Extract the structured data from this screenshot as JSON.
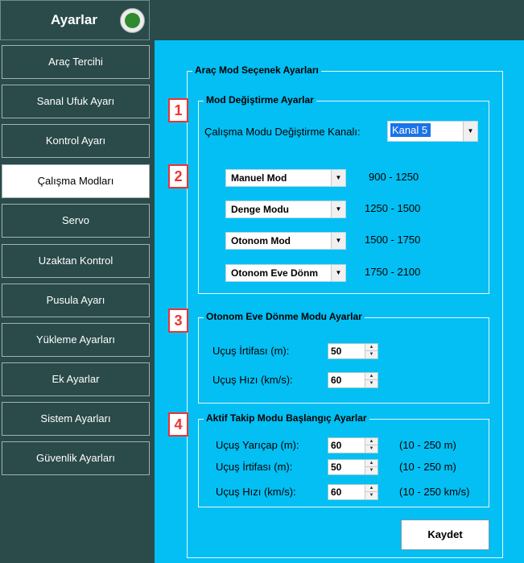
{
  "app": {
    "title": "Ayarlar",
    "logo_icon": "green-circle-logo-icon"
  },
  "sidebar": {
    "items": [
      {
        "label": "Araç Tercihi",
        "active": false
      },
      {
        "label": "Sanal Ufuk Ayarı",
        "active": false
      },
      {
        "label": "Kontrol Ayarı",
        "active": false
      },
      {
        "label": "Çalışma Modları",
        "active": true
      },
      {
        "label": "Servo",
        "active": false
      },
      {
        "label": "Uzaktan Kontrol",
        "active": false
      },
      {
        "label": "Pusula Ayarı",
        "active": false
      },
      {
        "label": "Yükleme Ayarları",
        "active": false
      },
      {
        "label": "Ek Ayarlar",
        "active": false
      },
      {
        "label": "Sistem Ayarları",
        "active": false
      },
      {
        "label": "Güvenlik Ayarları",
        "active": false
      }
    ]
  },
  "main": {
    "outer_title": "Araç Mod Seçenek Ayarları",
    "markers": [
      "1",
      "2",
      "3",
      "4"
    ],
    "mode_change": {
      "title": "Mod Değiştirme Ayarlar",
      "channel_label": "Çalışma Modu Değiştirme Kanalı:",
      "channel_value": "Kanal 5"
    },
    "modes": [
      {
        "value": "Manuel Mod",
        "range": "900 - 1250"
      },
      {
        "value": "Denge Modu",
        "range": "1250 - 1500"
      },
      {
        "value": "Otonom Mod",
        "range": "1500 - 1750"
      },
      {
        "value": "Otonom Eve Dönm",
        "range": "1750 - 2100"
      }
    ],
    "return_home": {
      "title": "Otonom Eve Dönme Modu Ayarlar",
      "altitude_label": "Uçuş İrtifası (m):",
      "altitude_value": "50",
      "speed_label": "Uçuş Hızı (km/s):",
      "speed_value": "60"
    },
    "follow": {
      "title": "Aktif Takip Modu Başlangıç Ayarlar",
      "radius_label": "Uçuş Yarıçap (m):",
      "radius_value": "60",
      "radius_range": "(10 - 250 m)",
      "altitude_label": "Uçuş İrtifası (m):",
      "altitude_value": "50",
      "altitude_range": "(10 - 250 m)",
      "speed_label": "Uçuş Hızı (km/s):",
      "speed_value": "60",
      "speed_range": "(10 - 250 km/s)"
    },
    "save_label": "Kaydet"
  },
  "colors": {
    "background": "#2b4a4a",
    "panel": "#03bff3",
    "marker": "#e33333",
    "selection": "#1a73e8"
  }
}
